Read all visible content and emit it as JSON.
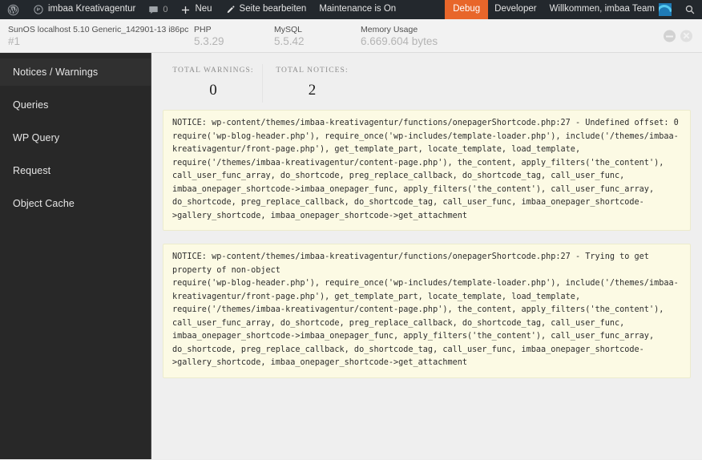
{
  "adminbar": {
    "wp_logo_name": "wordpress-logo-icon",
    "site_name": "imbaa Kreativagentur",
    "comments_count": "0",
    "new_label": "Neu",
    "edit_page_label": "Seite bearbeiten",
    "maintenance_label": "Maintenance is On",
    "debug_label": "Debug",
    "developer_label": "Developer",
    "greeting_label": "Willkommen, imbaa Team",
    "debug_bg": "#e8662a",
    "bar_bg": "#23282d"
  },
  "infobar": {
    "os_key": "SunOS localhost 5.10 Generic_142901-13 i86pc",
    "os_value": "#1",
    "php_key": "PHP",
    "php_value": "5.3.29",
    "mysql_key": "MySQL",
    "mysql_value": "5.5.42",
    "memory_key": "Memory Usage",
    "memory_value": "6.669.604 bytes"
  },
  "sidebar": {
    "items": [
      {
        "label": "Notices / Warnings",
        "active": true
      },
      {
        "label": "Queries",
        "active": false
      },
      {
        "label": "WP Query",
        "active": false
      },
      {
        "label": "Request",
        "active": false
      },
      {
        "label": "Object Cache",
        "active": false
      }
    ]
  },
  "stats": [
    {
      "label": "Total Warnings:",
      "value": "0"
    },
    {
      "label": "Total Notices:",
      "value": "2"
    }
  ],
  "notices": [
    {
      "text": "NOTICE: wp-content/themes/imbaa-kreativagentur/functions/onepagerShortcode.php:27 - Undefined offset: 0\nrequire('wp-blog-header.php'), require_once('wp-includes/template-loader.php'), include('/themes/imbaa-kreativagentur/front-page.php'), get_template_part, locate_template, load_template, require('/themes/imbaa-kreativagentur/content-page.php'), the_content, apply_filters('the_content'), call_user_func_array, do_shortcode, preg_replace_callback, do_shortcode_tag, call_user_func, imbaa_onepager_shortcode->imbaa_onepager_func, apply_filters('the_content'), call_user_func_array, do_shortcode, preg_replace_callback, do_shortcode_tag, call_user_func, imbaa_onepager_shortcode->gallery_shortcode, imbaa_onepager_shortcode->get_attachment"
    },
    {
      "text": "NOTICE: wp-content/themes/imbaa-kreativagentur/functions/onepagerShortcode.php:27 - Trying to get property of non-object\nrequire('wp-blog-header.php'), require_once('wp-includes/template-loader.php'), include('/themes/imbaa-kreativagentur/front-page.php'), get_template_part, locate_template, load_template, require('/themes/imbaa-kreativagentur/content-page.php'), the_content, apply_filters('the_content'), call_user_func_array, do_shortcode, preg_replace_callback, do_shortcode_tag, call_user_func, imbaa_onepager_shortcode->imbaa_onepager_func, apply_filters('the_content'), call_user_func_array, do_shortcode, preg_replace_callback, do_shortcode_tag, call_user_func, imbaa_onepager_shortcode->gallery_shortcode, imbaa_onepager_shortcode->get_attachment"
    }
  ]
}
